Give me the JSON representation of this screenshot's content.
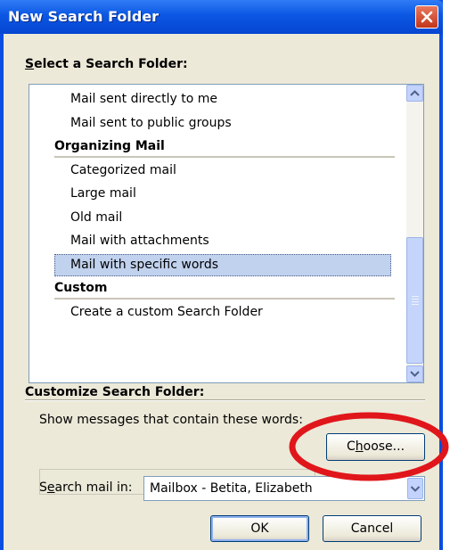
{
  "window": {
    "title": "New Search Folder"
  },
  "select_section": {
    "label_first": "S",
    "label_rest": "elect a Search Folder:"
  },
  "list": [
    {
      "kind": "item",
      "label": "Mail sent directly to me"
    },
    {
      "kind": "item",
      "label": "Mail sent to public groups"
    },
    {
      "kind": "header",
      "label": "Organizing Mail"
    },
    {
      "kind": "item",
      "label": "Categorized mail"
    },
    {
      "kind": "item",
      "label": "Large mail"
    },
    {
      "kind": "item",
      "label": "Old mail"
    },
    {
      "kind": "item",
      "label": "Mail with attachments"
    },
    {
      "kind": "item",
      "label": "Mail with specific words",
      "selected": true
    },
    {
      "kind": "header",
      "label": "Custom"
    },
    {
      "kind": "item",
      "label": "Create a custom Search Folder"
    }
  ],
  "customize": {
    "label": "Customize Search Folder:",
    "words_label": "Show messages that contain these words:",
    "words_value": "",
    "choose_button": {
      "before": "C",
      "underlined": "h",
      "after": "oose..."
    },
    "search_in_label": {
      "before": "S",
      "underlined": "e",
      "after": "arch mail in:"
    },
    "search_in_value": "Mailbox - Betita, Elizabeth"
  },
  "buttons": {
    "ok": "OK",
    "cancel": "Cancel"
  },
  "annotation": {
    "color": "#e0161b"
  }
}
